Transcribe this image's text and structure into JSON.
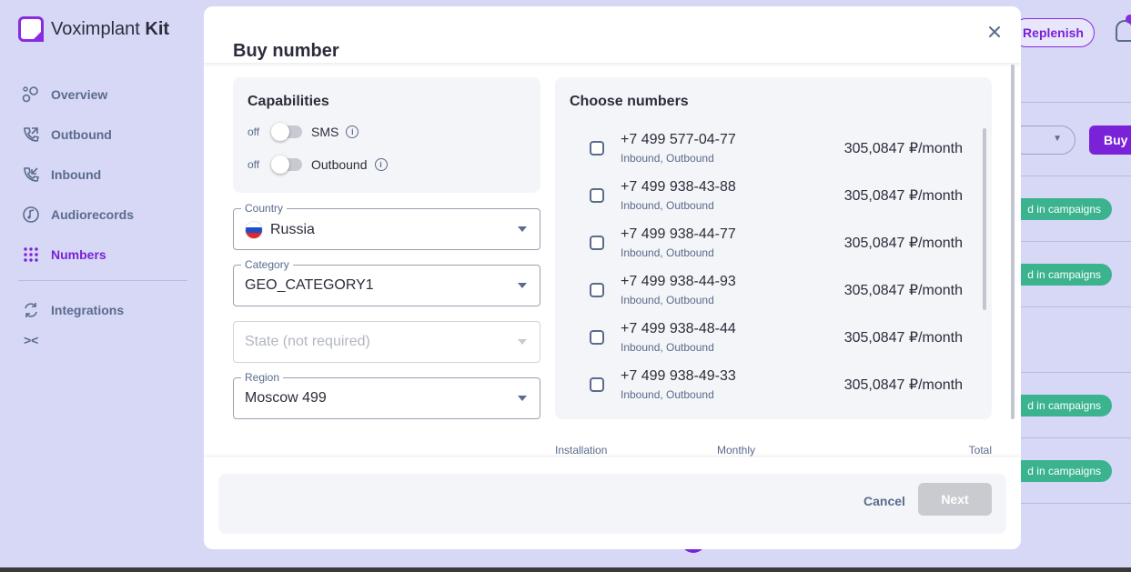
{
  "app": {
    "logo_name": "Voximplant",
    "logo_suffix": "Kit",
    "nav": [
      {
        "label": "Overview"
      },
      {
        "label": "Outbound"
      },
      {
        "label": "Inbound"
      },
      {
        "label": "Audiorecords"
      },
      {
        "label": "Numbers"
      },
      {
        "label": "Integrations"
      }
    ],
    "collapse_label": "><",
    "replenish_label": "Replenish",
    "buy_label": "Buy a",
    "campaign_pill": "d in campaigns",
    "accent_color": "#7a22d8"
  },
  "modal": {
    "title": "Buy number",
    "capabilities": {
      "title": "Capabilities",
      "items": [
        {
          "state": "off",
          "label": "SMS"
        },
        {
          "state": "off",
          "label": "Outbound"
        }
      ]
    },
    "fields": {
      "country": {
        "label": "Country",
        "value": "Russia"
      },
      "category": {
        "label": "Category",
        "value": "GEO_CATEGORY1"
      },
      "state": {
        "placeholder": "State (not required)"
      },
      "region": {
        "label": "Region",
        "value": "Moscow 499"
      }
    },
    "numbers": {
      "title": "Choose numbers",
      "items": [
        {
          "phone": "+7 499 577-04-77",
          "types": "Inbound, Outbound",
          "price": "305,0847 ₽/month"
        },
        {
          "phone": "+7 499 938-43-88",
          "types": "Inbound, Outbound",
          "price": "305,0847 ₽/month"
        },
        {
          "phone": "+7 499 938-44-77",
          "types": "Inbound, Outbound",
          "price": "305,0847 ₽/month"
        },
        {
          "phone": "+7 499 938-44-93",
          "types": "Inbound, Outbound",
          "price": "305,0847 ₽/month"
        },
        {
          "phone": "+7 499 938-48-44",
          "types": "Inbound, Outbound",
          "price": "305,0847 ₽/month"
        },
        {
          "phone": "+7 499 938-49-33",
          "types": "Inbound, Outbound",
          "price": "305,0847 ₽/month"
        }
      ]
    },
    "totals": {
      "installation": "Installation",
      "monthly": "Monthly",
      "total": "Total"
    },
    "footer": {
      "cancel_label": "Cancel",
      "next_label": "Next"
    }
  }
}
